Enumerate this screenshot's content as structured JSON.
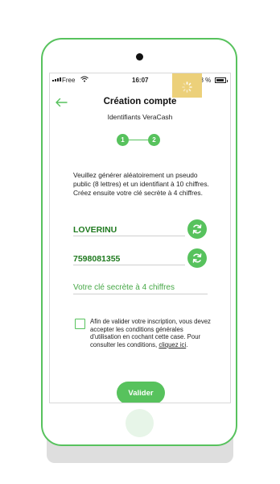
{
  "status_bar": {
    "carrier": "Free",
    "time": "16:07",
    "battery": "78 %"
  },
  "header": {
    "title": "Création compte",
    "subtitle": "Identifiants VeraCash"
  },
  "stepper": {
    "steps": [
      "1",
      "2"
    ],
    "active": 2
  },
  "instructions": "Veuillez générer aléatoirement un pseudo public (8 lettres) et un identifiant à 10 chiffres. Créez ensuite votre clé secrète à 4 chiffres.",
  "pseudo": {
    "value": "LOVERINU"
  },
  "identifier": {
    "value": "7598081355"
  },
  "secret_code": {
    "placeholder": "Votre clé secrète à 4 chiffres",
    "value": ""
  },
  "terms": {
    "checked": false,
    "text": "Afin de valider votre inscription, vous devez accepter les conditions générales d'utilisation en cochant cette case. Pour consulter les conditions,",
    "link": "cliquez ici",
    "link_suffix": "."
  },
  "submit_label": "Valider",
  "colors": {
    "accent_green": "#57c25d",
    "value_green": "#1f7a1f",
    "placeholder_green": "#47a847",
    "spinner_yellow": "#ecd07a"
  },
  "icons": {
    "back": "arrow-left-icon",
    "refresh": "refresh-icon",
    "wifi": "wifi-icon",
    "bluetooth": "bluetooth-icon",
    "battery": "battery-icon",
    "loading": "loading-spinner-icon"
  }
}
